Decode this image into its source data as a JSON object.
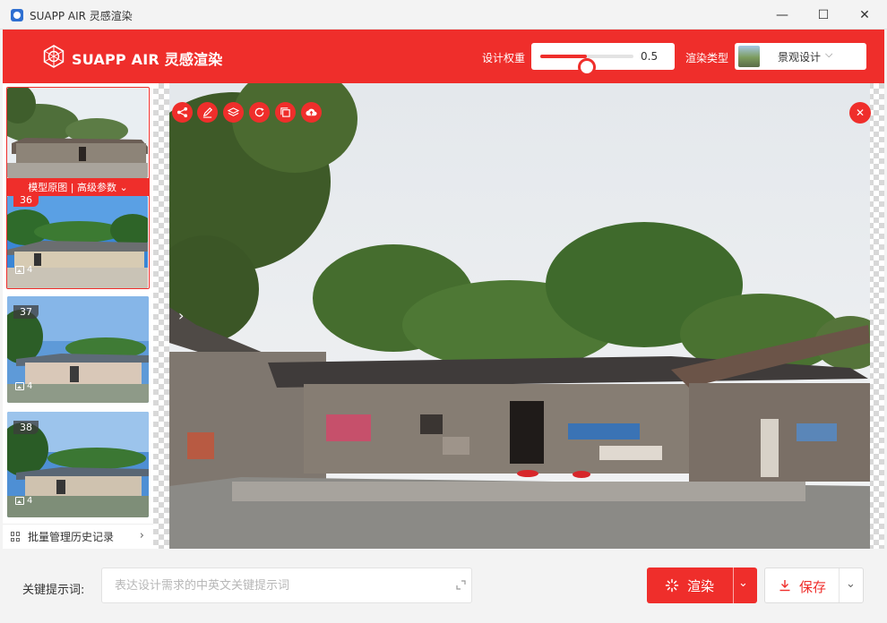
{
  "window": {
    "title": "SUAPP AIR 灵感渲染",
    "minimize": "—",
    "maximize": "☐",
    "close": "✕"
  },
  "header": {
    "logo_text": "SUAPP AIR 灵感渲染",
    "weight_label": "设计权重",
    "weight_value": "0.5",
    "weight_fraction": 0.5,
    "render_type_label": "渲染类型",
    "render_type_value": "景观设计"
  },
  "history": {
    "selected_bar": "模型原图 | 高级参数 ⌄",
    "items": [
      {
        "num": "36",
        "count": "4"
      },
      {
        "num": "37",
        "count": "4"
      },
      {
        "num": "38",
        "count": "4"
      }
    ],
    "manage_label": "批量管理历史记录"
  },
  "viewer": {
    "next_arrow": "›",
    "close": "✕"
  },
  "bottom": {
    "prompt_label": "关键提示词:",
    "prompt_placeholder": "表达设计需求的中英文关键提示词",
    "render_label": "渲染",
    "save_label": "保存",
    "caret": "⌄"
  },
  "colors": {
    "accent": "#ef2e2b",
    "titlebar": "#f3f3f3"
  }
}
